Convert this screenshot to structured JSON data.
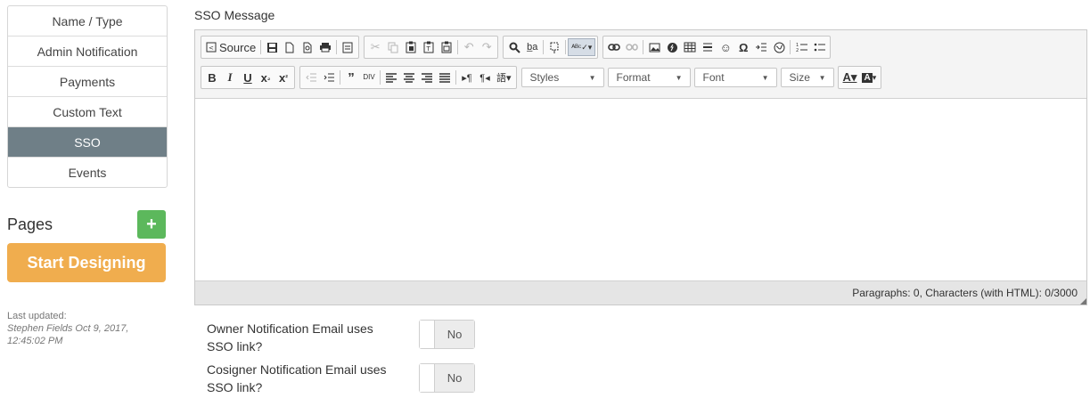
{
  "sidebar": {
    "items": [
      {
        "label": "Name / Type"
      },
      {
        "label": "Admin Notification"
      },
      {
        "label": "Payments"
      },
      {
        "label": "Custom Text"
      },
      {
        "label": "SSO",
        "active": true
      },
      {
        "label": "Events"
      }
    ],
    "pages_title": "Pages",
    "add_label": "+",
    "start_label": "Start Designing",
    "last_updated_label": "Last updated:",
    "last_updated_value": "Stephen Fields Oct 9, 2017, 12:45:02 PM"
  },
  "editor": {
    "section_label": "SSO Message",
    "source_label": "Source",
    "styles": "Styles",
    "format": "Format",
    "font": "Font",
    "size": "Size",
    "status": "Paragraphs: 0, Characters (with HTML): 0/3000",
    "content": ""
  },
  "options": [
    {
      "label": "Owner Notification Email uses SSO link?",
      "value": "No"
    },
    {
      "label": "Cosigner Notification Email uses SSO link?",
      "value": "No"
    }
  ],
  "colors": {
    "active_nav": "#6f7f87",
    "add_button": "#5cb85c",
    "start_button": "#f0ad4e"
  }
}
